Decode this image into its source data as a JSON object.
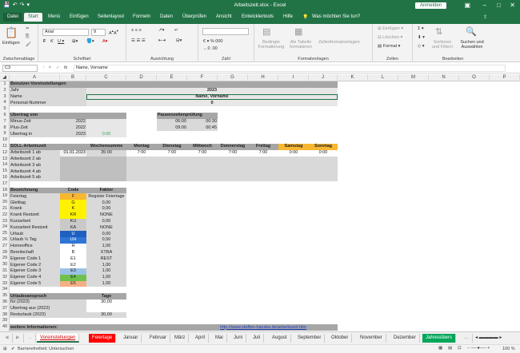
{
  "window": {
    "title": "Arbeitszeit.xlsx  -  Excel",
    "signin": "Anmelden"
  },
  "ribbon_tabs": [
    "Datei",
    "Start",
    "Menü",
    "Einfügen",
    "Seitenlayout",
    "Formeln",
    "Daten",
    "Überprüfen",
    "Ansicht",
    "Entwicklertools",
    "Hilfe"
  ],
  "search_label": "Was möchten Sie tun?",
  "ribbon": {
    "paste": "Einfügen",
    "clipboard": "Zwischenablage",
    "font": "Schriftart",
    "font_name": "Arial",
    "font_size": "9",
    "alignment": "Ausrichtung",
    "number": "Zahl",
    "cond": "Bedingte Formatierung",
    "table": "Als Tabelle formatieren",
    "styles_cmd": "Zellenformatvorlagen",
    "styles": "Formatvorlagen",
    "insert": "Einfügen",
    "delete": "Löschen",
    "format": "Format",
    "cells": "Zellen",
    "sort": "Sortieren und Filtern",
    "find": "Suchen und Auswählen",
    "editing": "Bearbeiten"
  },
  "namebox": "C3",
  "formula": "Name, Vorname",
  "columns": [
    "A",
    "B",
    "C",
    "D",
    "E",
    "F",
    "G",
    "H",
    "I",
    "J",
    "K",
    "L",
    "M",
    "N",
    "O",
    "P"
  ],
  "rows": [
    "1",
    "2",
    "3",
    "4",
    "5",
    "6",
    "7",
    "8",
    "9",
    "10",
    "11",
    "12",
    "13",
    "14",
    "15",
    "16",
    "17",
    "18",
    "19",
    "20",
    "21",
    "22",
    "23",
    "24",
    "25",
    "26",
    "27",
    "28",
    "29",
    "30",
    "31",
    "32",
    "33",
    "34",
    "35",
    "36",
    "37",
    "38",
    "39",
    "40"
  ],
  "cells": {
    "r1": "Benutzer-Voreinstellungen",
    "jahr": "Jahr",
    "jahr_v": "2023",
    "name": "Name",
    "name_v": "Name, Vorname",
    "pn": "Personal-Nummer",
    "pn_v": "0",
    "uv": "Übertrag von",
    "minus": "Minus-Zeit",
    "minus_v": "2022",
    "plus": "Plus-Zeit",
    "plus_v": "2022",
    "uin": "Übertrag in",
    "uin_v": "2023",
    "uin_x": "0:00",
    "pause": "Pausenzeitenprüfung",
    "p1a": "06:00",
    "p1b": "00:30",
    "p2a": "09:00",
    "p2b": "00:45",
    "soll": "SOLL-Arbeitszeit",
    "woche": "Wochensumme",
    "mo": "Montag",
    "di": "Dienstag",
    "mi": "Mittwoch",
    "do": "Donnerstag",
    "fr": "Freitag",
    "sa": "Samstag",
    "so": "Sonntag",
    "az1": "Arbeitszeit 1 ab",
    "az1_d": "01.01.2023",
    "az1_w": "35:00",
    "t7": "7:00",
    "t0": "0:00",
    "az2": "Arbeitszeit 2 ab",
    "az3": "Arbeitszeit 3 ab",
    "az4": "Arbeitszeit 4 ab",
    "az5": "Arbeitszeit 5 ab",
    "bez": "Bezeichnung",
    "code": "Code",
    "faktor": "Faktor",
    "urlaub": "Urlaubsanspruch",
    "tage": "Tage",
    "fuer": "für (2023)",
    "fuer_v": "30,00",
    "uaus": "Übertrag aus (2022)",
    "rest": "Resturlaub (2023)",
    "rest_v": "30,00",
    "info": "weitere Informationen:",
    "link": "http://www.steffen-hanske.de/arbeitszeit.htm"
  },
  "codes": [
    {
      "name": "Feiertag",
      "code": "F",
      "factor": "Register Feiertage",
      "color": "#f7b731"
    },
    {
      "name": "Gleittag",
      "code": "G",
      "factor": "0,00",
      "color": "#fef200"
    },
    {
      "name": "Krank",
      "code": "K",
      "factor": "0,00",
      "color": "#fef200"
    },
    {
      "name": "Krank Restzeit",
      "code": "KR",
      "factor": "NONE",
      "color": "#fef200"
    },
    {
      "name": "Kurzarbeit",
      "code": "KU",
      "factor": "0,00",
      "color": "#c9c9c9"
    },
    {
      "name": "Kurzarbeit Restzeit",
      "code": "KA",
      "factor": "NONE",
      "color": "#c9c9c9"
    },
    {
      "name": "Urlaub",
      "code": "U",
      "factor": "0,00",
      "color": "#1f5fbf"
    },
    {
      "name": "Urlaub ½ Tag",
      "code": "UH",
      "factor": "0,50",
      "color": "#2f75d6"
    },
    {
      "name": "Homeoffice",
      "code": "H",
      "factor": "1,00",
      "color": "#ffffff"
    },
    {
      "name": "Bereitschaft",
      "code": "B",
      "factor": "XTRA",
      "color": "#ffffff"
    },
    {
      "name": "Eigener Code 1",
      "code": "E1",
      "factor": "REST",
      "color": "#ffffff"
    },
    {
      "name": "Eigener Code 2",
      "code": "E2",
      "factor": "1,00",
      "color": "#ffffff"
    },
    {
      "name": "Eigener Code 3",
      "code": "E3",
      "factor": "1,00",
      "color": "#9bc2e6"
    },
    {
      "name": "Eigener Code 4",
      "code": "E4",
      "factor": "1,00",
      "color": "#70c050"
    },
    {
      "name": "Eigener Code 5",
      "code": "E5",
      "factor": "1,00",
      "color": "#f4b084"
    }
  ],
  "sheets": [
    "Voreinstellungen",
    "Feiertage",
    "Januar",
    "Februar",
    "März",
    "April",
    "Mai",
    "Juni",
    "Juli",
    "August",
    "September",
    "Oktober",
    "November",
    "Dezember",
    "Jahresübers"
  ],
  "status": {
    "access": "Barrierefreiheit: Untersuchen",
    "zoom": "100 %"
  },
  "colors": {
    "excel_green": "#217346",
    "header_gray": "#a6a6a6",
    "weekend_orange": "#f7b731",
    "sheet_red": "#ff0000",
    "sheet_green": "#00a65a"
  }
}
